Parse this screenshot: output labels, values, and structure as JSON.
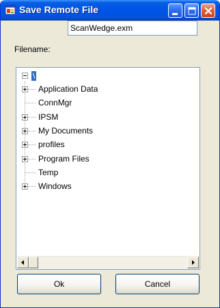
{
  "window": {
    "title": "Save Remote File",
    "icon": "app-window-icon",
    "controls": [
      "minimize-icon",
      "maximize-icon",
      "close-icon"
    ]
  },
  "form": {
    "filename_label": "Filename:",
    "filename_value": "ScanWedge.exm"
  },
  "tree": {
    "root_label": "\\",
    "root_expanded": true,
    "children": [
      {
        "label": "Application Data",
        "expandable": true
      },
      {
        "label": "ConnMgr",
        "expandable": false
      },
      {
        "label": "IPSM",
        "expandable": true
      },
      {
        "label": "My Documents",
        "expandable": true
      },
      {
        "label": "profiles",
        "expandable": true
      },
      {
        "label": "Program Files",
        "expandable": true
      },
      {
        "label": "Temp",
        "expandable": false
      },
      {
        "label": "Windows",
        "expandable": true
      }
    ]
  },
  "buttons": {
    "ok_label": "Ok",
    "cancel_label": "Cancel"
  },
  "colors": {
    "titlebar": "#0054e3",
    "selection": "#316ac5",
    "face": "#ece9d8"
  }
}
